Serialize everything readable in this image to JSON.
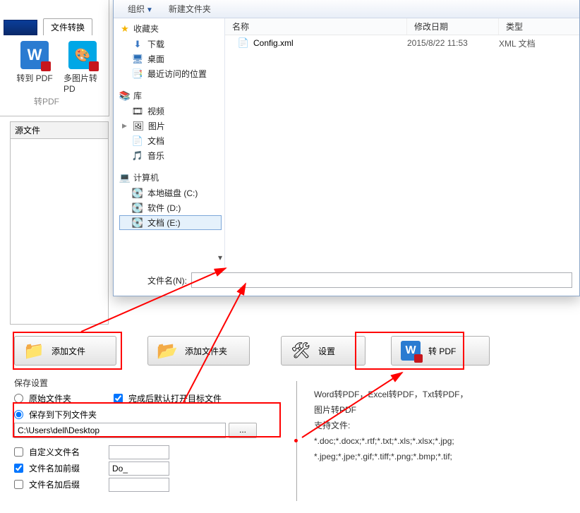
{
  "top": {
    "tab_label": "文件转换",
    "icon1_label": "转到 PDF",
    "icon2_label": "多图片转PD",
    "section_label": "转PDF"
  },
  "source_files_header": "源文件",
  "dialog": {
    "toolbar": {
      "organize": "组织",
      "newfolder": "新建文件夹"
    },
    "nav": {
      "fav_title": "收藏夹",
      "fav_items": [
        "下载",
        "桌面",
        "最近访问的位置"
      ],
      "lib_title": "库",
      "lib_items": [
        "视频",
        "图片",
        "文档",
        "音乐"
      ],
      "comp_title": "计算机",
      "comp_items": [
        "本地磁盘 (C:)",
        "软件 (D:)",
        "文档 (E:)"
      ]
    },
    "columns": {
      "name": "名称",
      "date": "修改日期",
      "type": "类型"
    },
    "row": {
      "filename": "Config.xml",
      "date": "2015/8/22 11:53",
      "type": "XML 文档"
    },
    "fn_label": "文件名(N):"
  },
  "buttons": {
    "add_file": "添加文件",
    "add_folder": "添加文件夹",
    "settings": "设置",
    "convert": "转 PDF"
  },
  "save": {
    "header": "保存设置",
    "orig": "原始文件夹",
    "open_after": "完成后默认打开目标文件",
    "save_to": "保存到下列文件夹",
    "path": "C:\\Users\\dell\\Desktop",
    "browse": "...",
    "custom_name": "自定义文件名",
    "prefix": "文件名加前缀",
    "prefix_val": "Do_",
    "suffix": "文件名加后缀"
  },
  "info": {
    "l1": "Word转PDF，Excel转PDF，Txt转PDF，",
    "l2": "图片转PDF",
    "l3": "支持文件:",
    "l4": "*.doc;*.docx;*.rtf;*.txt;*.xls;*.xlsx;*.jpg;",
    "l5": "*.jpeg;*.jpe;*.gif;*.tiff;*.png;*.bmp;*.tif;"
  },
  "chart_data": null
}
